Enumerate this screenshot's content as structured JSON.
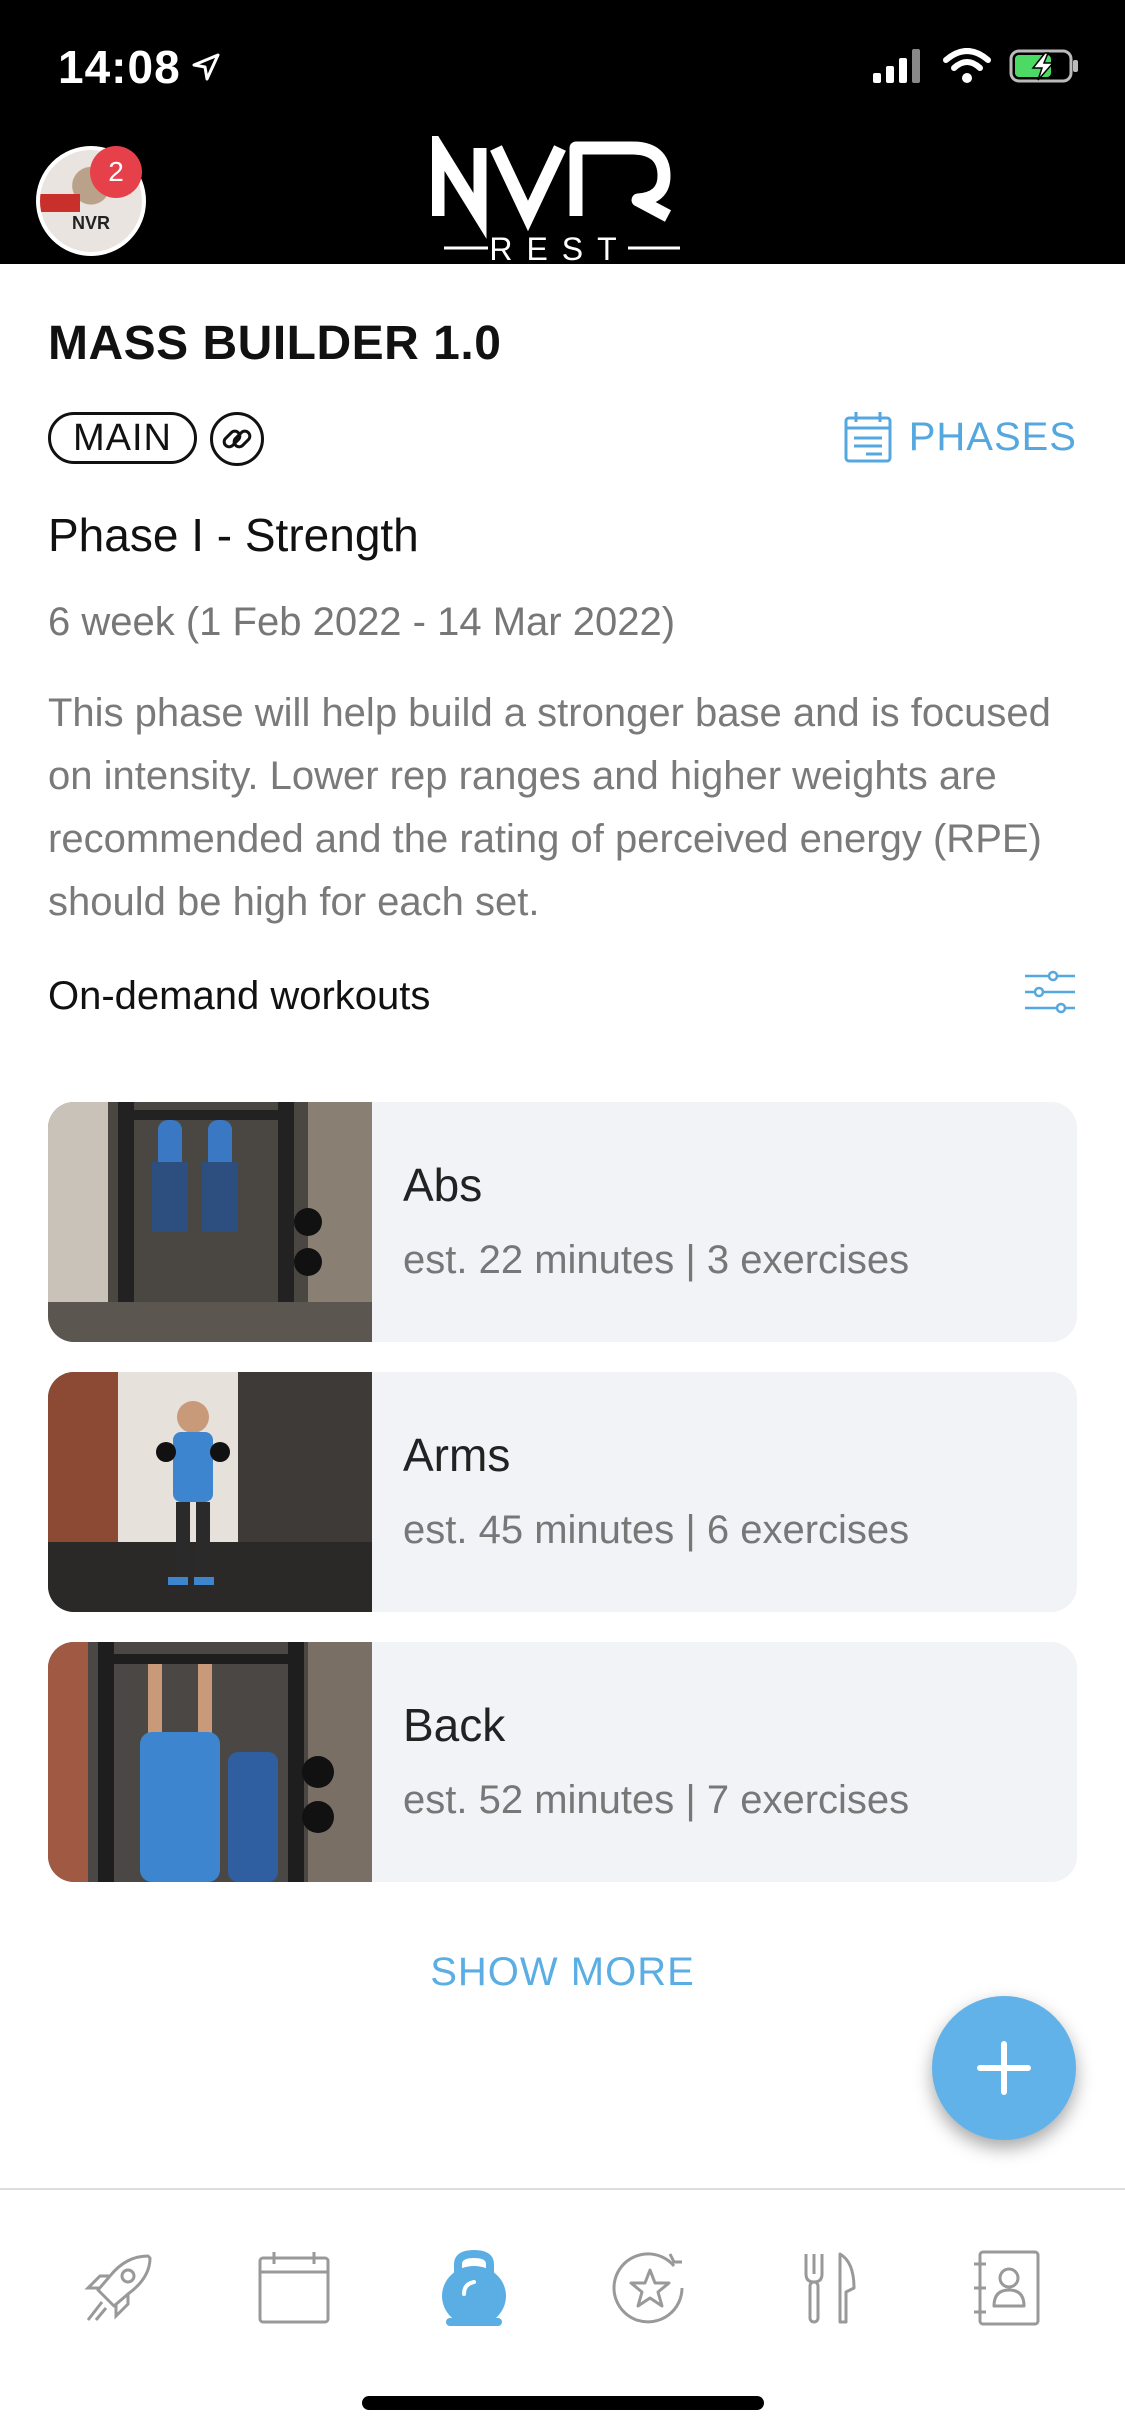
{
  "status_bar": {
    "time": "14:08"
  },
  "header": {
    "notification_count": "2",
    "avatar_text": "NVR",
    "logo_main": "NVR",
    "logo_sub": "REST"
  },
  "program": {
    "title": "MASS BUILDER 1.0",
    "tag": "MAIN",
    "phases_label": "PHASES"
  },
  "phase": {
    "title": "Phase I - Strength",
    "dates": "6 week (1 Feb 2022 - 14 Mar 2022)",
    "description": "This phase will help build a stronger base and is focused on intensity. Lower rep ranges and higher weights are recommended and the rating of perceived energy (RPE) should be high for each set."
  },
  "section": {
    "title": "On-demand workouts"
  },
  "workouts": [
    {
      "name": "Abs",
      "meta": "est. 22 minutes | 3 exercises"
    },
    {
      "name": "Arms",
      "meta": "est. 45 minutes | 6 exercises"
    },
    {
      "name": "Back",
      "meta": "est. 52 minutes | 7 exercises"
    }
  ],
  "show_more": "SHOW MORE",
  "tabbar": {
    "icons": [
      "rocket-icon",
      "calendar-icon",
      "kettlebell-icon",
      "star-badge-icon",
      "fork-knife-icon",
      "contact-book-icon"
    ],
    "active_index": 2
  },
  "colors": {
    "accent": "#55a8df",
    "badge": "#e6414b",
    "card_bg": "#f2f3f7",
    "header_bg": "#000000"
  }
}
